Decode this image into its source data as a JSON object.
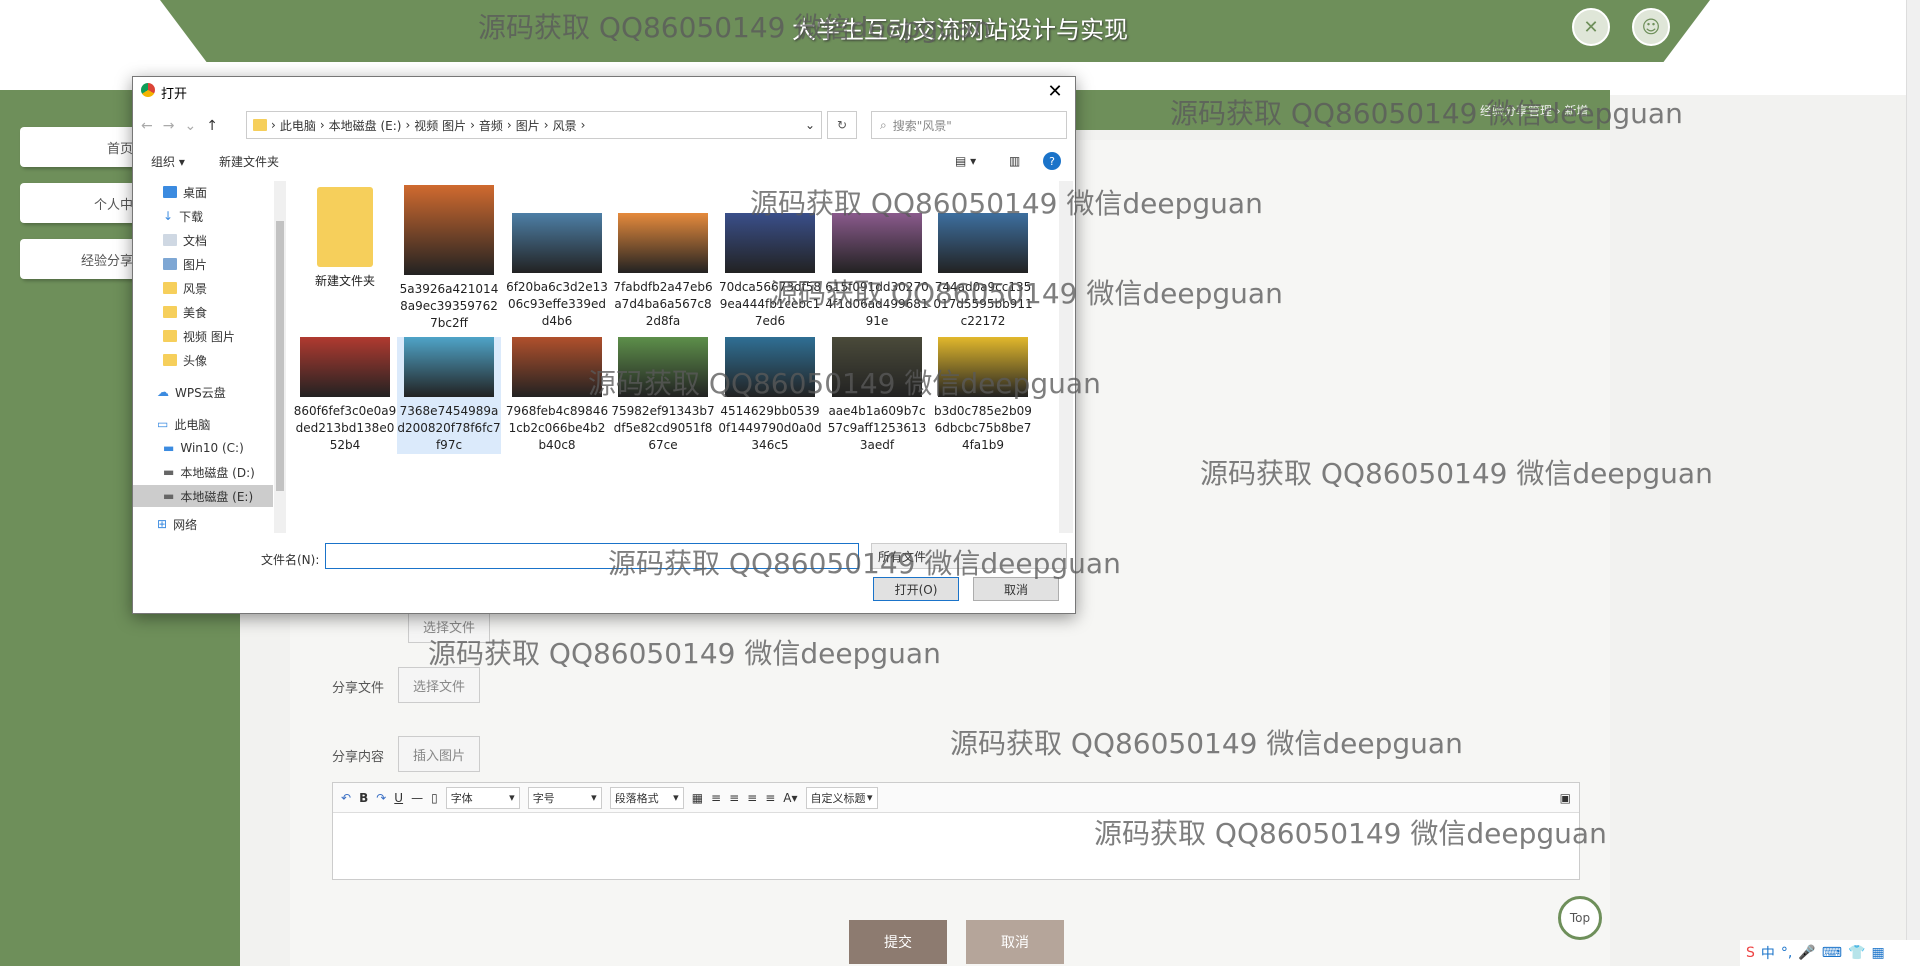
{
  "site": {
    "title": "大学生互动交流网站设计与实现",
    "nav": [
      "首页",
      "个人中心",
      "经验分享管理"
    ],
    "content_header": "经验分享管理 › 新增"
  },
  "form": {
    "upload_button": "选择文件",
    "share_file_label": "分享文件",
    "share_file_button": "选择文件",
    "content_label": "分享内容",
    "insert_image_button": "插入图片",
    "toolbar": {
      "font": "字体",
      "size": "字号",
      "paragraph": "段落格式",
      "custom_title": "自定义标题"
    },
    "submit": "提交",
    "cancel": "取消"
  },
  "top_button": "Top",
  "ime": {
    "lang": "中"
  },
  "watermark": "源码获取 QQ86050149 微信deepguan",
  "dialog": {
    "title": "打开",
    "breadcrumb": [
      "此电脑",
      "本地磁盘 (E:)",
      "视频 图片",
      "音频",
      "图片",
      "风景"
    ],
    "search_placeholder": "搜索\"风景\"",
    "organize": "组织 ▾",
    "new_folder": "新建文件夹",
    "nav_pane": [
      "桌面",
      "下载",
      "文档",
      "图片",
      "风景",
      "美食",
      "视频 图片",
      "头像",
      "WPS云盘",
      "此电脑",
      "Win10 (C:)",
      "本地磁盘 (D:)",
      "本地磁盘 (E:)",
      "网络"
    ],
    "files": [
      {
        "name": "新建文件夹",
        "color": "#f6cf5b"
      },
      {
        "name": "5a3926a4210148a9ec393597627bc2ff",
        "color": "#d06a2f"
      },
      {
        "name": "6f20ba6c3d2e1306c93effe339edd4b6",
        "color": "#4d7fa6"
      },
      {
        "name": "7fabdfb2a47eb6a7d4ba6a567c82d8fa",
        "color": "#e58a3c"
      },
      {
        "name": "70dca56673df589ea444fb1cebc17ed6",
        "color": "#3a4f8a"
      },
      {
        "name": "615f091dd302704f1d06ad49968191e",
        "color": "#8a5a8c"
      },
      {
        "name": "744ad0a9cc135017d5595bb911c22172",
        "color": "#3d6f9f"
      },
      {
        "name": "860f6fef3c0e0a9ded213bd138e052b4",
        "color": "#b03a30"
      },
      {
        "name": "7368e7454989ad200820f78f6fc7f97c",
        "color": "#4fa4c8"
      },
      {
        "name": "7968feb4c898461cb2c066be4b2b40c8",
        "color": "#b0502c"
      },
      {
        "name": "75982ef91343b7df5e82cd9051f867ce",
        "color": "#5d8f4a"
      },
      {
        "name": "4514629bb05390f1449790d0a0d346c5",
        "color": "#2f6f94"
      },
      {
        "name": "aae4b1a609b7c57c9aff12536133aedf",
        "color": "#4a4a3a"
      },
      {
        "name": "b3d0c785e2b096dbcbc75b8be74fa1b9",
        "color": "#e2b82c"
      }
    ],
    "filename_label": "文件名(N):",
    "filetype": "所有文件",
    "open": "打开(O)",
    "cancel": "取消"
  }
}
